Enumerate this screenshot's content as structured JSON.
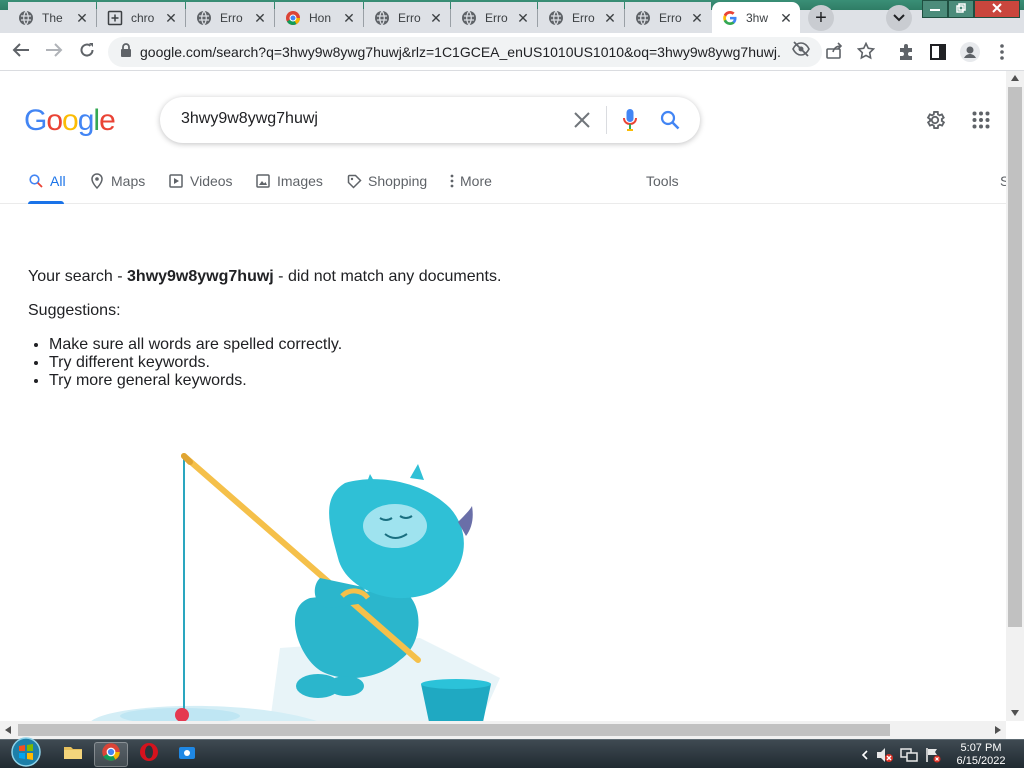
{
  "browser": {
    "tabs": [
      {
        "title": "The",
        "favicon": "globe-icon"
      },
      {
        "title": "chro",
        "favicon": "plus-box-icon"
      },
      {
        "title": "Erro",
        "favicon": "globe-icon"
      },
      {
        "title": "Hon",
        "favicon": "chrome-icon"
      },
      {
        "title": "Erro",
        "favicon": "globe-icon"
      },
      {
        "title": "Erro",
        "favicon": "globe-icon"
      },
      {
        "title": "Erro",
        "favicon": "globe-icon"
      },
      {
        "title": "Erro",
        "favicon": "globe-icon"
      },
      {
        "title": "3hw",
        "favicon": "google-g-icon",
        "active": true
      }
    ],
    "close_glyph": "✕",
    "new_tab_glyph": "+",
    "url": "google.com/search?q=3hwy9w8ywg7huwj&rlz=1C1GCEA_enUS1010US1010&oq=3hwy9w8ywg7huwj..."
  },
  "google": {
    "logo": [
      "G",
      "o",
      "o",
      "g",
      "l",
      "e"
    ],
    "logo_colors": [
      "#4285f4",
      "#ea4335",
      "#fbbc05",
      "#4285f4",
      "#34a853",
      "#ea4335"
    ],
    "query": "3hwy9w8ywg7huwj",
    "tabs": [
      {
        "label": "All",
        "icon": "search-icon",
        "active": true
      },
      {
        "label": "Maps",
        "icon": "map-pin-icon"
      },
      {
        "label": "Videos",
        "icon": "play-icon"
      },
      {
        "label": "Images",
        "icon": "image-icon"
      },
      {
        "label": "Shopping",
        "icon": "tag-icon"
      },
      {
        "label": "More",
        "icon": "more-vert-icon"
      }
    ],
    "tools_label": "Tools",
    "safesearch_label": "S",
    "result": {
      "prefix": "Your search - ",
      "query": "3hwy9w8ywg7huwj",
      "suffix": " - did not match any documents.",
      "suggestions_title": "Suggestions:",
      "suggestions": [
        "Make sure all words are spelled correctly.",
        "Try different keywords.",
        "Try more general keywords."
      ]
    },
    "accent": "#1a73e8"
  },
  "taskbar": {
    "time": "5:07 PM",
    "date": "6/15/2022"
  }
}
